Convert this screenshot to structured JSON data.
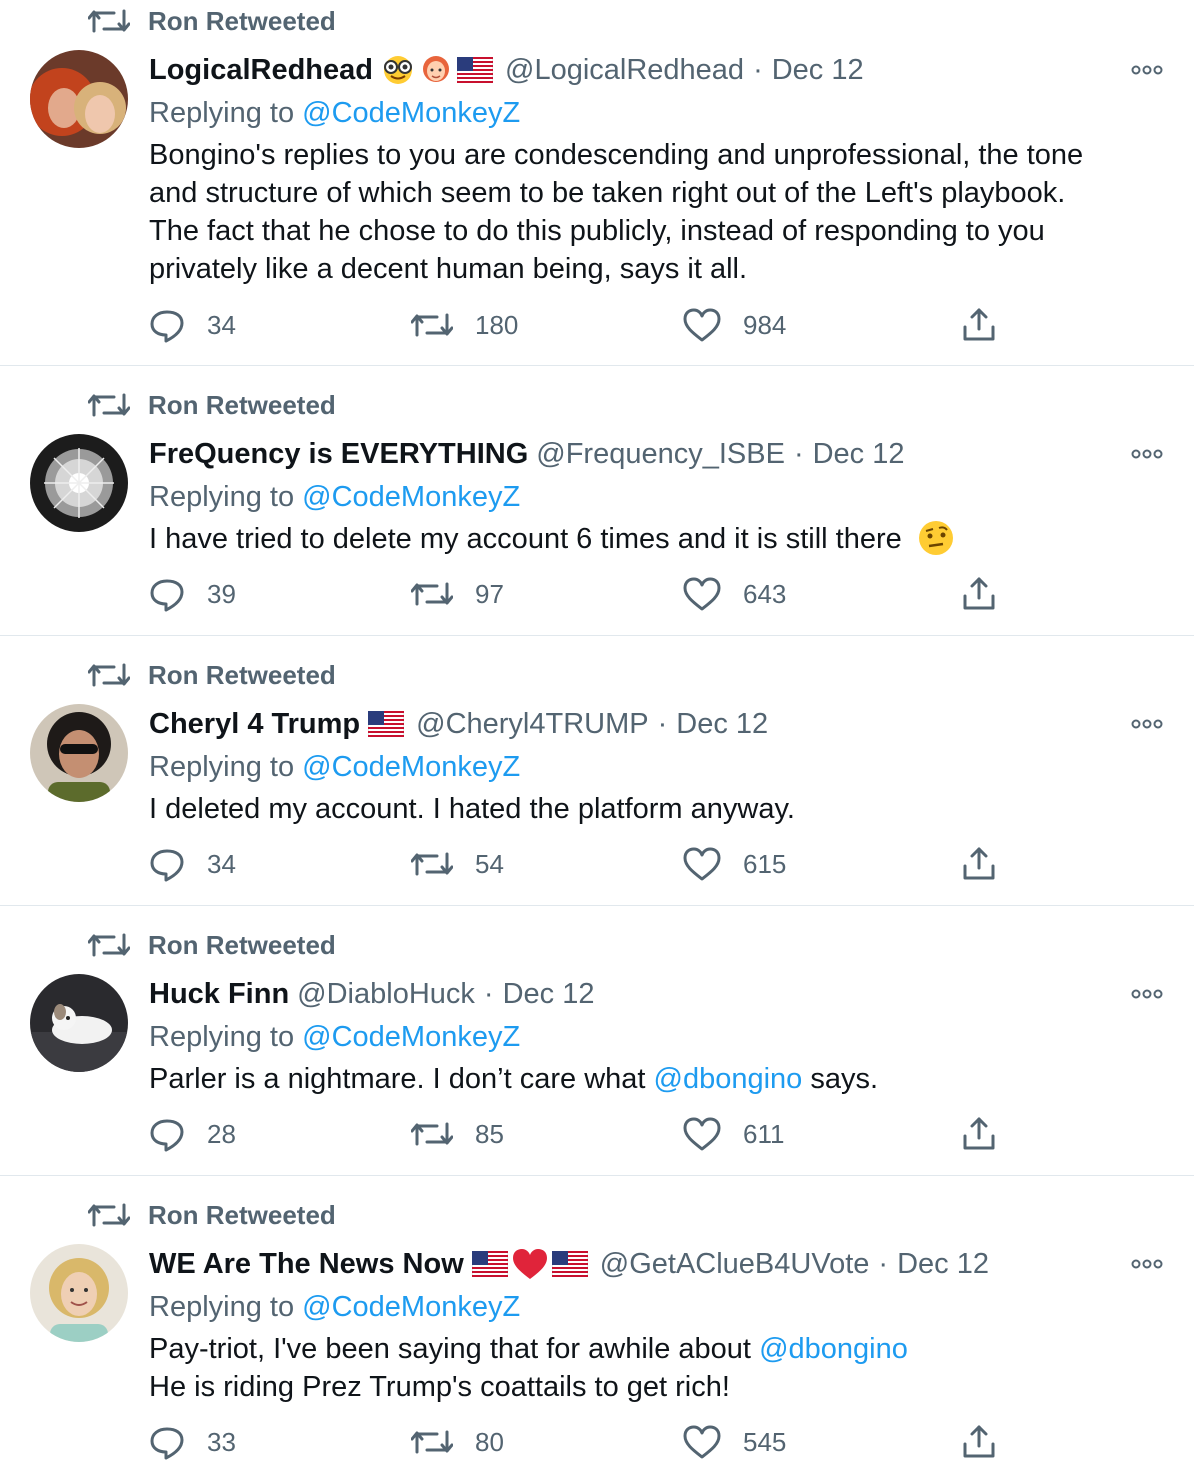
{
  "tweets": [
    {
      "retweet_label": "Ron Retweeted",
      "name": "LogicalRedhead",
      "badges": [
        "nerd-face-emoji",
        "red-haired-woman-emoji",
        "us-flag-emoji"
      ],
      "handle": "@LogicalRedhead",
      "separator": "·",
      "date": "Dec 12",
      "replying_prefix": "Replying to ",
      "replying_to": "@CodeMonkeyZ",
      "text_lines": [
        "Bongino's replies to you are condescending and unprofessional, the tone",
        "and structure of which seem to be taken right out of the Left's playbook.",
        "The fact that he chose to do this publicly, instead of responding to you",
        "privately like a decent human being, says it all."
      ],
      "replies": "34",
      "retweets": "180",
      "likes": "984"
    },
    {
      "retweet_label": "Ron Retweeted",
      "name": "FreQuency is EVERYTHING",
      "badges": [],
      "handle": "@Frequency_ISBE",
      "separator": "·",
      "date": "Dec 12",
      "replying_prefix": "Replying to ",
      "replying_to": "@CodeMonkeyZ",
      "text": "I have tried to delete my account 6 times and it is still there",
      "text_emoji": "raised-eyebrow-emoji",
      "replies": "39",
      "retweets": "97",
      "likes": "643"
    },
    {
      "retweet_label": "Ron Retweeted",
      "name": "Cheryl 4 Trump",
      "badges": [
        "us-flag-emoji"
      ],
      "handle": "@Cheryl4TRUMP",
      "separator": "·",
      "date": "Dec 12",
      "replying_prefix": "Replying to ",
      "replying_to": "@CodeMonkeyZ",
      "text": "I deleted my account. I hated the platform anyway.",
      "replies": "34",
      "retweets": "54",
      "likes": "615"
    },
    {
      "retweet_label": "Ron Retweeted",
      "name": "Huck Finn",
      "badges": [],
      "handle": "@DiabloHuck",
      "separator": "·",
      "date": "Dec 12",
      "replying_prefix": "Replying to ",
      "replying_to": "@CodeMonkeyZ",
      "text_before": "Parler is a nightmare. I don’t care what ",
      "text_mention": "@dbongino",
      "text_after": " says.",
      "replies": "28",
      "retweets": "85",
      "likes": "611"
    },
    {
      "retweet_label": "Ron Retweeted",
      "name": "WE Are The News Now",
      "badges": [
        "us-flag-emoji",
        "red-heart-emoji",
        "us-flag-emoji"
      ],
      "handle": "@GetAClueB4UVote",
      "separator": "·",
      "date": "Dec 12",
      "replying_prefix": "Replying to ",
      "replying_to": "@CodeMonkeyZ",
      "text_before": "Pay-triot, I've been saying that for awhile about ",
      "text_mention": "@dbongino",
      "text_line2": "He is riding Prez Trump's coattails to get rich!",
      "replies": "33",
      "retweets": "80",
      "likes": "545"
    }
  ],
  "colors": {
    "text": "#0f1419",
    "muted": "#536471",
    "link": "#1d9bf0",
    "divider": "#e1e8ed"
  }
}
